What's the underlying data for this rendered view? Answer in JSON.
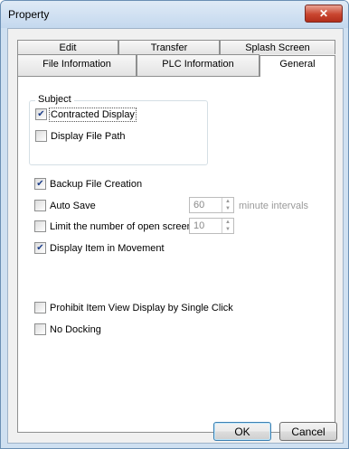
{
  "window": {
    "title": "Property",
    "close_glyph": "✕"
  },
  "tabs": {
    "row1": [
      {
        "label": "Edit"
      },
      {
        "label": "Transfer"
      },
      {
        "label": "Splash Screen"
      }
    ],
    "row2": [
      {
        "label": "File Information"
      },
      {
        "label": "PLC Information"
      },
      {
        "label": "General",
        "active": true
      }
    ]
  },
  "general": {
    "subject": {
      "title": "Subject",
      "contracted_display": {
        "label": "Contracted Display",
        "checked": true
      },
      "display_file_path": {
        "label": "Display File Path",
        "checked": false
      }
    },
    "backup_file_creation": {
      "label": "Backup File Creation",
      "checked": true
    },
    "auto_save": {
      "label": "Auto Save",
      "checked": false,
      "value": "60",
      "unit": "minute intervals"
    },
    "limit_open_screens": {
      "label": "Limit the number of open screens",
      "checked": false,
      "value": "10"
    },
    "display_item_in_movement": {
      "label": "Display Item in Movement",
      "checked": true
    },
    "prohibit_item_view": {
      "label": "Prohibit Item View Display by Single Click",
      "checked": false
    },
    "no_docking": {
      "label": "No Docking",
      "checked": false
    }
  },
  "buttons": {
    "ok": "OK",
    "cancel": "Cancel"
  },
  "colors": {
    "accent": "#3c7fb1",
    "close": "#c9452f",
    "check": "#1e3f8a"
  },
  "glyphs": {
    "check": "✔",
    "spin_up": "▲",
    "spin_down": "▼"
  }
}
